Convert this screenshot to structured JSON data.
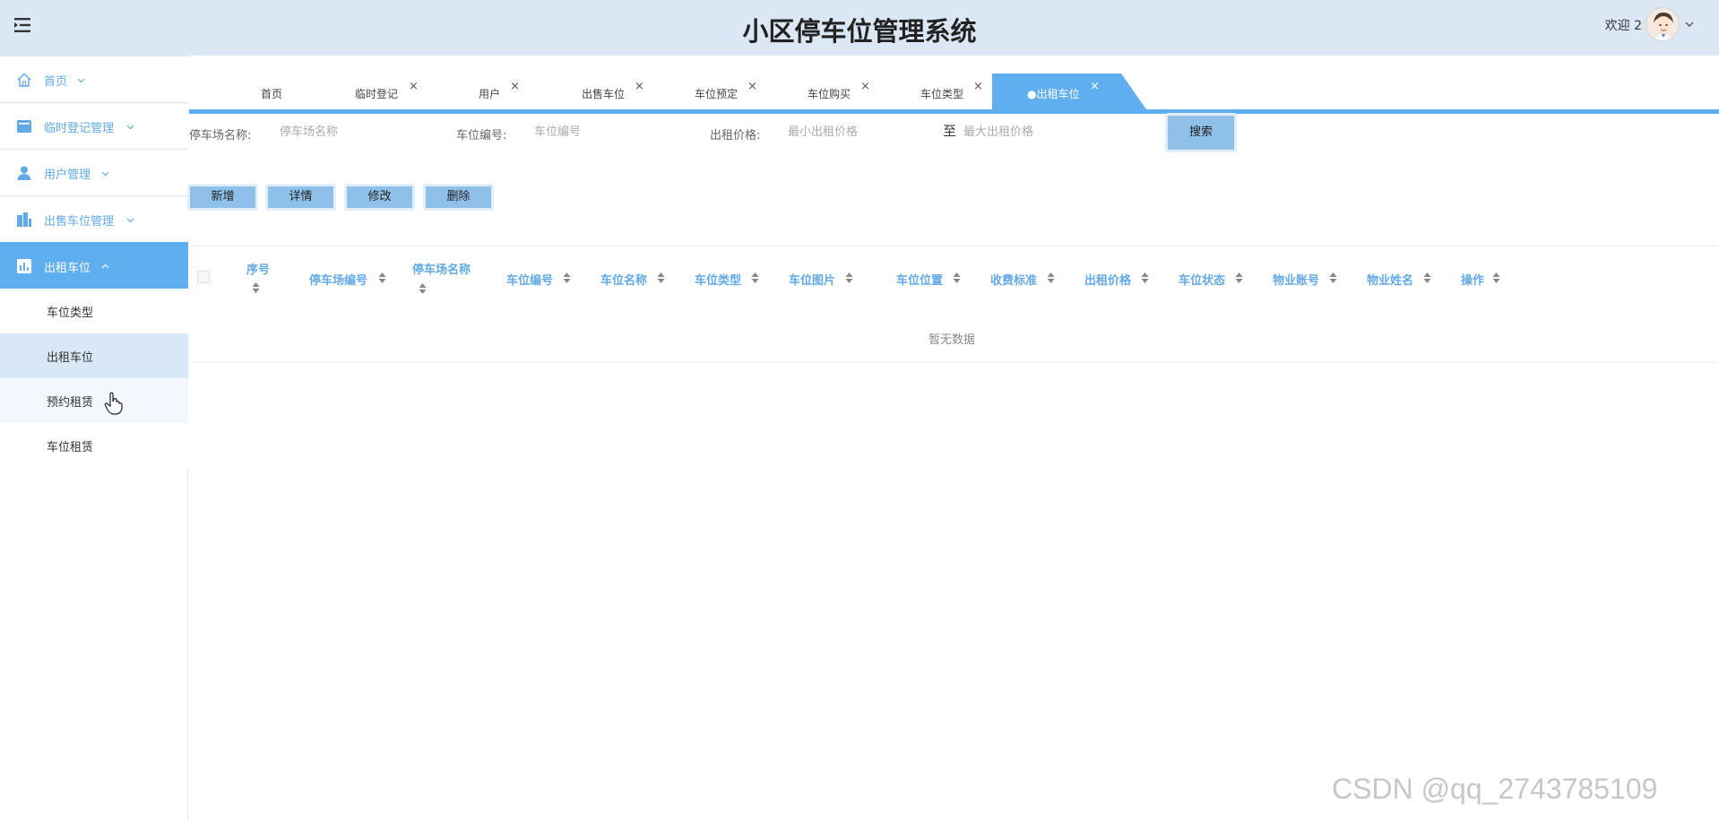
{
  "header": {
    "title": "小区停车位管理系统",
    "welcome": "欢迎 2"
  },
  "sidebar": {
    "menus": [
      {
        "label": "首页",
        "icon": "home-icon"
      },
      {
        "label": "临时登记管理",
        "icon": "document-icon"
      },
      {
        "label": "用户管理",
        "icon": "user-icon"
      },
      {
        "label": "出售车位管理",
        "icon": "building-icon"
      },
      {
        "label": "出租车位",
        "icon": "chart-icon"
      }
    ],
    "submenu": [
      {
        "label": "车位类型"
      },
      {
        "label": "出租车位"
      },
      {
        "label": "预约租赁"
      },
      {
        "label": "车位租赁"
      }
    ]
  },
  "tabs": [
    {
      "label": "首页"
    },
    {
      "label": "临时登记",
      "close": "×"
    },
    {
      "label": "用户",
      "close": "×"
    },
    {
      "label": "出售车位",
      "close": "×"
    },
    {
      "label": "车位预定",
      "close": "×"
    },
    {
      "label": "车位购买",
      "close": "×"
    },
    {
      "label": "车位类型",
      "close": "×"
    },
    {
      "label": "●出租车位",
      "close": "×"
    }
  ],
  "search": {
    "parking_name_label": "停车场名称:",
    "parking_name_placeholder": "停车场名称",
    "space_no_label": "车位编号:",
    "space_no_placeholder": "车位编号",
    "price_label": "出租价格:",
    "price_min_placeholder": "最小出租价格",
    "to_label": "至",
    "price_max_placeholder": "最大出租价格",
    "search_button": "搜索"
  },
  "actions": {
    "add": "新增",
    "detail": "详情",
    "edit": "修改",
    "delete": "删除"
  },
  "table": {
    "columns": [
      "序号",
      "停车场编号",
      "停车场名称",
      "车位编号",
      "车位名称",
      "车位类型",
      "车位图片",
      "车位位置",
      "收费标准",
      "出租价格",
      "车位状态",
      "物业账号",
      "物业姓名",
      "操作"
    ],
    "empty_text": "暂无数据"
  },
  "watermark": "CSDN @qq_2743785109",
  "colors": {
    "header_bg": "#dbe7f4",
    "accent": "#5faeef",
    "link_text": "#62a9e7",
    "button_bg": "#8fc0e9"
  }
}
